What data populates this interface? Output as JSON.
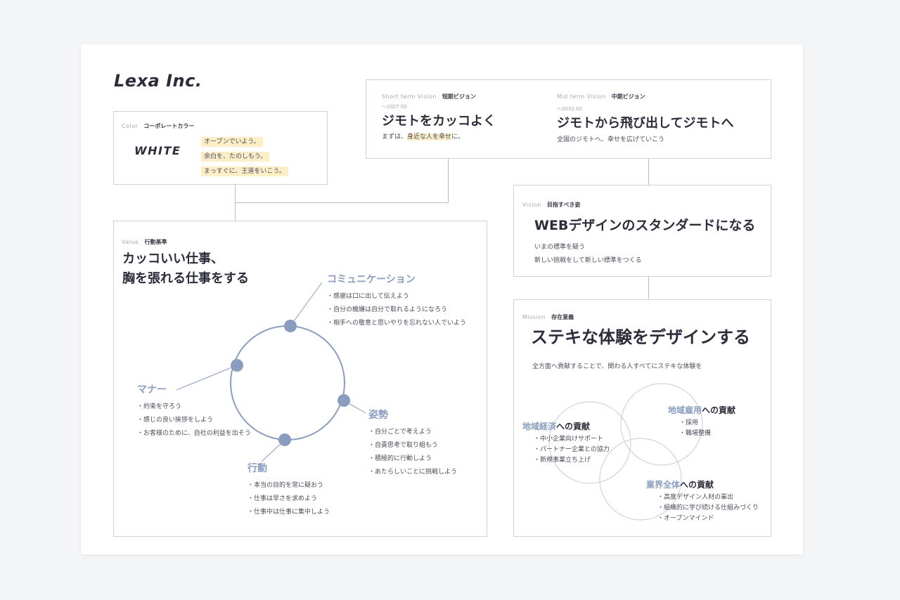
{
  "logo": "Lexa Inc.",
  "color": {
    "tag_en": "Color",
    "tag_ja": "コーポレートカラー",
    "name": "WHITE",
    "phrases": [
      "オープンでいよう。",
      "余白を、たのしもう。",
      "まっすぐに、王道をいこう。"
    ],
    "highlight_color": "#fcefc8"
  },
  "short_vision": {
    "tag_en": "Short term Vision",
    "tag_ja": "短期ビジョン",
    "date": "〜2027.02",
    "title": "ジモトをカッコよく",
    "desc_pre": "まずは、",
    "desc_hl": "身近な人を幸せ",
    "desc_post": "に。"
  },
  "mid_vision": {
    "tag_en": "Mid term Vision",
    "tag_ja": "中期ビジョン",
    "date": "〜2032.02",
    "title": "ジモトから飛び出してジモトへ",
    "desc": "全国のジモトへ、幸せを広げていこう"
  },
  "vision": {
    "tag_en": "Vision",
    "tag_ja": "目指すべき姿",
    "title": "WEBデザインのスタンダードになる",
    "lines": [
      "いまの標準を疑う",
      "新しい挑戦をして新しい標準をつくる"
    ]
  },
  "mission": {
    "tag_en": "Mission",
    "tag_ja": "存在意義",
    "title": "ステキな体験をデザインする",
    "desc": "全方面へ貢献することで、関わる人すべてにステキな体験を",
    "areas": [
      {
        "accent": "地域経済",
        "suffix": "への貢献",
        "items": [
          "中小企業向けサポート",
          "パートナー企業との協力",
          "新規事業立ち上げ"
        ]
      },
      {
        "accent": "地域雇用",
        "suffix": "への貢献",
        "items": [
          "採用",
          "職場整備"
        ]
      },
      {
        "accent": "業界全体",
        "suffix": "への貢献",
        "items": [
          "高度デザイン人材の輩出",
          "組織的に学び続ける仕組みづくり",
          "オープンマインド"
        ]
      }
    ]
  },
  "value": {
    "tag_en": "Value",
    "tag_ja": "行動基準",
    "title_line1": "カッコいい仕事、",
    "title_line2": "胸を張れる仕事をする",
    "groups": [
      {
        "name": "コミュニケーション",
        "items": [
          "感謝は口に出して伝えよう",
          "自分の機嫌は自分で取れるようになろう",
          "相手への敬意と思いやりを忘れない人でいよう"
        ]
      },
      {
        "name": "マナー",
        "items": [
          "約束を守ろう",
          "感じの良い挨拶をしよう",
          "お客様のために、自社の利益を出そう"
        ]
      },
      {
        "name": "姿勢",
        "items": [
          "自分ごとで考えよう",
          "自責思考で取り組もう",
          "積極的に行動しよう",
          "あたらしいことに挑戦しよう"
        ]
      },
      {
        "name": "行動",
        "items": [
          "本当の目的を常に疑おう",
          "仕事は早さを求めよう",
          "仕事中は仕事に集中しよう"
        ]
      }
    ]
  },
  "accent_color": "#8a9dbf"
}
